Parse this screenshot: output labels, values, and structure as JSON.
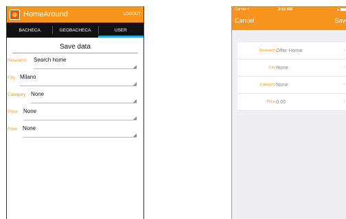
{
  "android": {
    "app_title": "HomeAround",
    "logout_label": "LOGOUT",
    "tabs": [
      {
        "label": "BACHECA"
      },
      {
        "label": "GEOBACHECA"
      },
      {
        "label": "USER"
      }
    ],
    "active_tab": "USER",
    "form_title": "Save data",
    "fields": [
      {
        "label": "Research",
        "value": "Search home"
      },
      {
        "label": "City",
        "value": "Milano"
      },
      {
        "label": "Category",
        "value": "None"
      },
      {
        "label": "Price",
        "value": "None"
      },
      {
        "label": "Area",
        "value": "None"
      }
    ],
    "icons": {
      "logo": "app-logo-icon",
      "dropdown": "dropdown-triangle-icon"
    },
    "colors": {
      "accent": "#f7941d",
      "tab_bar": "#111111",
      "tab_indicator": "#29a9e1"
    }
  },
  "ios": {
    "carrier": "Carrier",
    "time": "3:16 AM",
    "cancel_label": "Cancel",
    "save_label": "Save",
    "fields": [
      {
        "label": "Research",
        "value": "Offer Home"
      },
      {
        "label": "City",
        "value": "None"
      },
      {
        "label": "Category",
        "value": "None"
      },
      {
        "label": "Price",
        "value": "0.00"
      }
    ],
    "icons": {
      "wifi": "wifi-icon",
      "battery": "battery-icon",
      "chevron": "chevron-right-icon"
    },
    "colors": {
      "accent": "#f7941d",
      "background": "#efeff4"
    }
  }
}
